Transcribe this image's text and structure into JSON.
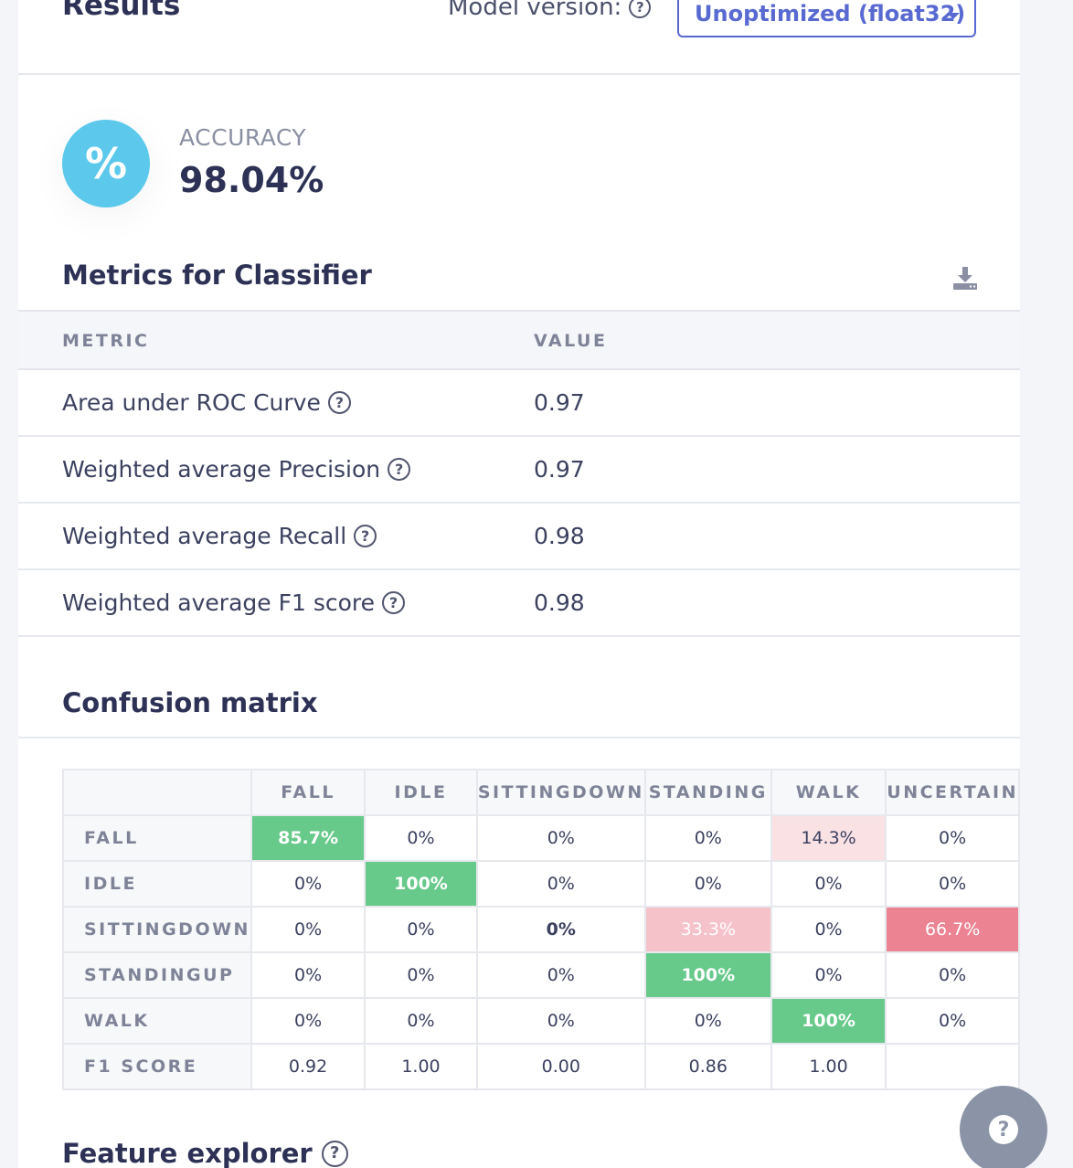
{
  "header": {
    "title": "Results",
    "model_version_label": "Model version:",
    "model_version_value": "Unoptimized (float32)"
  },
  "accuracy": {
    "icon": "percent-icon",
    "label": "ACCURACY",
    "value": "98.04%"
  },
  "metrics": {
    "title": "Metrics for Classifier",
    "download_icon": "download-icon",
    "headers": [
      "METRIC",
      "VALUE"
    ],
    "rows": [
      {
        "name": "Area under ROC Curve",
        "value": "0.97"
      },
      {
        "name": "Weighted average Precision",
        "value": "0.97"
      },
      {
        "name": "Weighted average Recall",
        "value": "0.98"
      },
      {
        "name": "Weighted average F1 score",
        "value": "0.98"
      }
    ]
  },
  "confusion": {
    "title": "Confusion matrix",
    "columns": [
      "FALL",
      "IDLE",
      "SITTINGDOWN",
      "STANDING",
      "WALK",
      "UNCERTAIN"
    ],
    "rows": [
      {
        "label": "FALL",
        "cells": [
          "85.7%",
          "0%",
          "0%",
          "0%",
          "14.3%",
          "0%"
        ]
      },
      {
        "label": "IDLE",
        "cells": [
          "0%",
          "100%",
          "0%",
          "0%",
          "0%",
          "0%"
        ]
      },
      {
        "label": "SITTINGDOWN",
        "cells": [
          "0%",
          "0%",
          "0%",
          "33.3%",
          "0%",
          "66.7%"
        ]
      },
      {
        "label": "STANDINGUP",
        "cells": [
          "0%",
          "0%",
          "0%",
          "100%",
          "0%",
          "0%"
        ]
      },
      {
        "label": "WALK",
        "cells": [
          "0%",
          "0%",
          "0%",
          "0%",
          "100%",
          "0%"
        ]
      },
      {
        "label": "F1 SCORE",
        "cells": [
          "0.92",
          "1.00",
          "0.00",
          "0.86",
          "1.00",
          ""
        ]
      }
    ],
    "colors": {
      "good": "#67c98a",
      "bad_light": "#f9e1e4",
      "bad_mid": "#f5c2ca",
      "bad_strong": "#eb8393"
    }
  },
  "feature_explorer": {
    "title": "Feature explorer"
  },
  "help_fab": {
    "icon": "help-icon"
  },
  "colors": {
    "accent": "#5869d1",
    "accuracy_icon_bg": "#5bc8ec"
  }
}
